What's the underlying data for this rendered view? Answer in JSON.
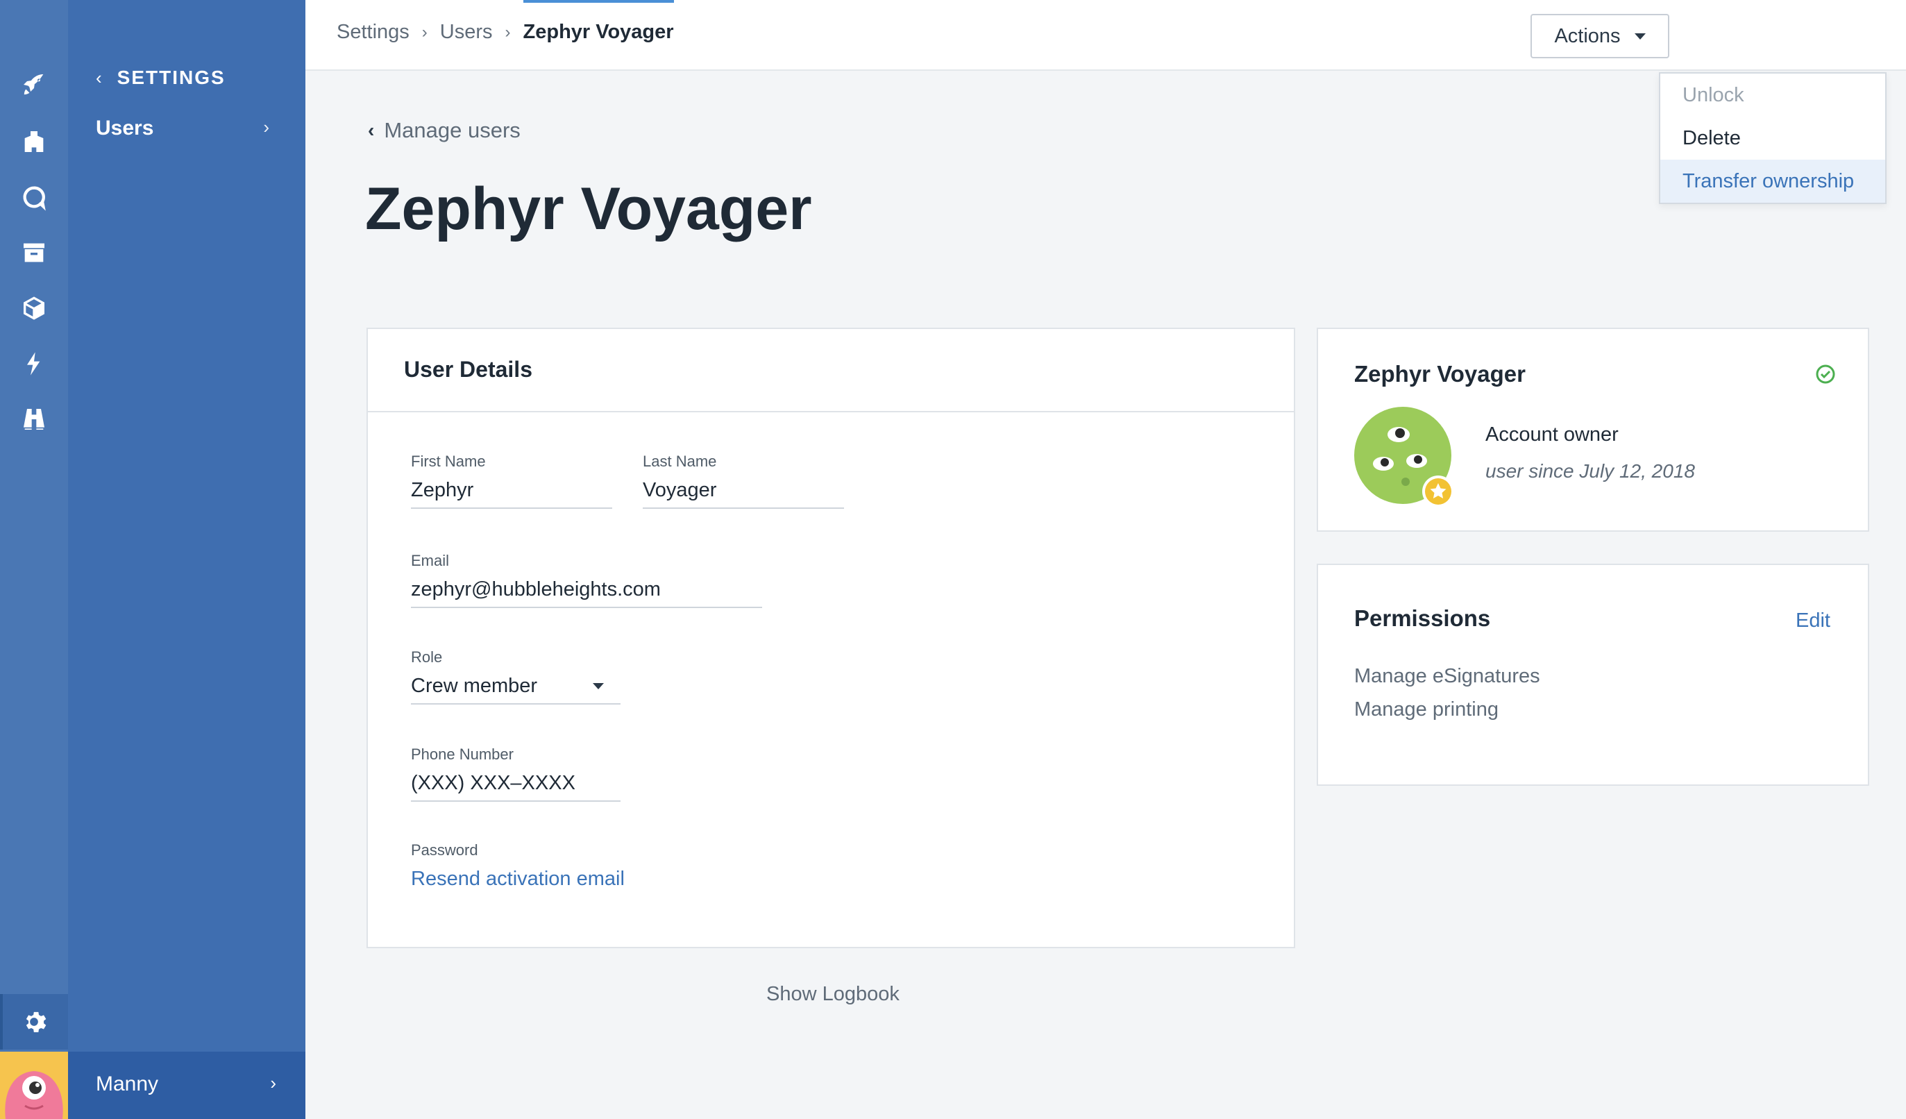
{
  "sidebar": {
    "back_label": "SETTINGS",
    "items": [
      {
        "label": "Users"
      }
    ],
    "user_name": "Manny",
    "rail_icons": [
      "rocket-icon",
      "building-icon",
      "chat-icon",
      "archive-icon",
      "cube-icon",
      "bolt-icon",
      "binoculars-icon",
      "gear-icon"
    ]
  },
  "header": {
    "breadcrumbs": [
      "Settings",
      "Users",
      "Zephyr Voyager"
    ],
    "actions_label": "Actions",
    "actions_menu": [
      "Unlock",
      "Delete",
      "Transfer ownership"
    ]
  },
  "main": {
    "back_label": "Manage users",
    "title": "Zephyr Voyager",
    "show_logbook": "Show Logbook"
  },
  "details": {
    "heading": "User Details",
    "first_name": {
      "label": "First Name",
      "value": "Zephyr"
    },
    "last_name": {
      "label": "Last Name",
      "value": "Voyager"
    },
    "email": {
      "label": "Email",
      "value": "zephyr@hubbleheights.com"
    },
    "role": {
      "label": "Role",
      "value": "Crew member"
    },
    "phone": {
      "label": "Phone Number",
      "value": "(XXX) XXX–XXXX"
    },
    "password": {
      "label": "Password",
      "link": "Resend activation email"
    }
  },
  "profile": {
    "name": "Zephyr Voyager",
    "role": "Account owner",
    "since": "user since July 12, 2018"
  },
  "permissions": {
    "heading": "Permissions",
    "edit_label": "Edit",
    "items": [
      "Manage eSignatures",
      "Manage printing"
    ]
  },
  "colors": {
    "rail": "#4a77b4",
    "panel": "#3f6eb0",
    "accent": "#3a73b8",
    "avatar_green": "#9ccb5a",
    "badge_yellow": "#f2c233",
    "verified_green": "#4caf50"
  }
}
